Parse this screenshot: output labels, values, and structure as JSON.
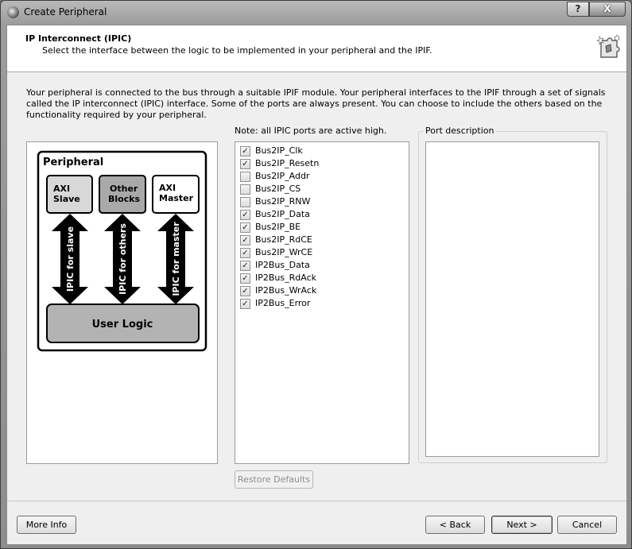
{
  "window": {
    "title": "Create Peripheral",
    "help_label": "?",
    "close_label": "X"
  },
  "header": {
    "title": "IP Interconnect (IPIC)",
    "subtitle": "Select the interface between the logic to be implemented in your peripheral and the IPIF."
  },
  "description": "Your peripheral is connected to the bus through a suitable IPIF module. Your peripheral interfaces to the IPIF through a set of signals called the IP interconnect (IPIC) interface. Some of the ports are always present. You can choose to include the others based on the functionality required by your peripheral.",
  "diagram": {
    "title": "Peripheral",
    "blocks": [
      {
        "line1": "AXI",
        "line2": "Slave"
      },
      {
        "line1": "Other",
        "line2": "Blocks"
      },
      {
        "line1": "AXI",
        "line2": "Master"
      }
    ],
    "arrows": [
      "IPIC for slave",
      "IPIC for others",
      "IPIC for master"
    ],
    "user_logic": "User Logic"
  },
  "ports": {
    "note": "Note: all IPIC ports are active high.",
    "items": [
      {
        "label": "Bus2IP_Clk",
        "checked": true
      },
      {
        "label": "Bus2IP_Resetn",
        "checked": true
      },
      {
        "label": "Bus2IP_Addr",
        "checked": false
      },
      {
        "label": "Bus2IP_CS",
        "checked": false
      },
      {
        "label": "Bus2IP_RNW",
        "checked": false
      },
      {
        "label": "Bus2IP_Data",
        "checked": true
      },
      {
        "label": "Bus2IP_BE",
        "checked": true
      },
      {
        "label": "Bus2IP_RdCE",
        "checked": true
      },
      {
        "label": "Bus2IP_WrCE",
        "checked": true
      },
      {
        "label": "IP2Bus_Data",
        "checked": true
      },
      {
        "label": "IP2Bus_RdAck",
        "checked": true
      },
      {
        "label": "IP2Bus_WrAck",
        "checked": true
      },
      {
        "label": "IP2Bus_Error",
        "checked": true
      }
    ],
    "restore_label": "Restore Defaults"
  },
  "port_description": {
    "label": "Port description",
    "text": ""
  },
  "buttons": {
    "more_info": "More Info",
    "back": "< Back",
    "next": "Next >",
    "cancel": "Cancel"
  },
  "colors": {
    "block_light": "#d8d8d8",
    "block_dark": "#a9a9a9",
    "user_logic": "#b3b3b3"
  }
}
